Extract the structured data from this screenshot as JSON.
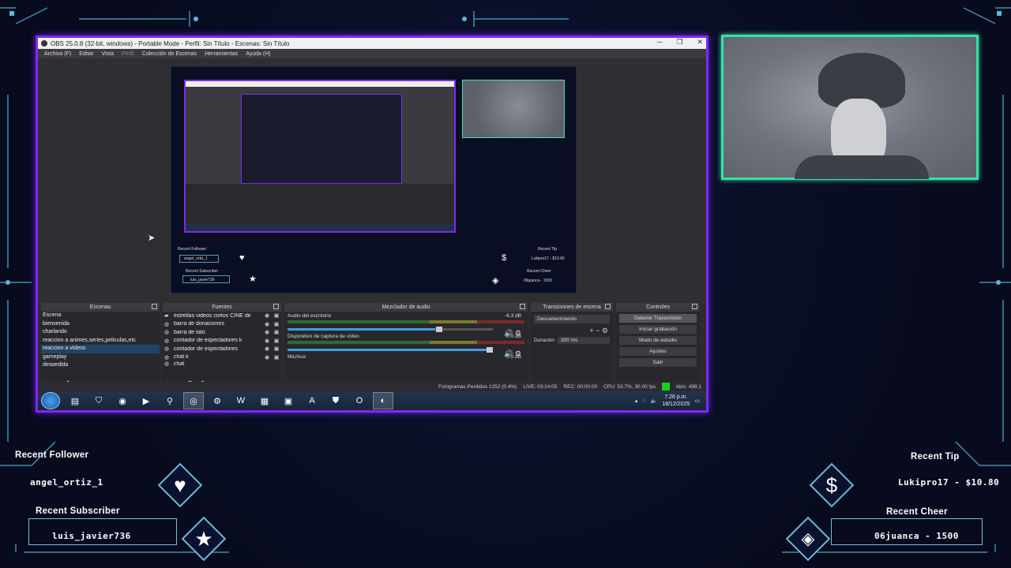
{
  "obs": {
    "title": "OBS 25.0.8 (32-bit, windows) - Portable Mode - Perfil: Sin Título - Escenas: Sin Título",
    "menu": [
      "Archivo (F)",
      "Editar",
      "Vista",
      "Perfil",
      "Colección de Escenas",
      "Herramientas",
      "Ayuda (H)"
    ],
    "docks": {
      "scenes": {
        "header": "Escenas",
        "items": [
          "Escena",
          "bienvenida",
          "charlando",
          "reaccion a animes,series,peliculas,etc",
          "reaccion a videos",
          "gameplay",
          "despedida"
        ],
        "selected_index": 4
      },
      "sources": {
        "header": "Fuentes",
        "items": [
          "estrellas videos cortos CINE de",
          "barra de donaciones",
          "barra de tato",
          "contador de espectadores k",
          "contador de espectadores",
          "chat k",
          "chat"
        ]
      },
      "mixer": {
        "header": "Mezclador de audio",
        "channels": [
          {
            "name": "Audio del escritorio",
            "db": "-6.3 dB",
            "level": 0.72
          },
          {
            "name": "Dispositivo de captura de vídeo",
            "db": "0.0 dB",
            "level": 0.98
          },
          {
            "name": "Mic/Aux",
            "db": "0.0 dB",
            "level": 0.98
          }
        ]
      },
      "transitions": {
        "header": "Transiciones de escena",
        "type": "Desvanecimiento",
        "duration_label": "Duración",
        "duration_value": "300 ms"
      },
      "controls": {
        "header": "Controles",
        "buttons": [
          "Detener Transmisión",
          "Iniciar grabación",
          "Modo de estudio",
          "Ajustes",
          "Salir"
        ]
      }
    },
    "status": {
      "dropped": "Fotogramas Perdidos 1252 (0.4%)",
      "live": "LIVE: 03:14:05",
      "rec": "REC: 00:00:00",
      "cpu": "CPU: 53.7%, 30.00 fps",
      "kbps": "kb/s: 498.1"
    },
    "taskbar": {
      "time": "7:26 p.m.",
      "date": "18/12/2025"
    },
    "preview_mini": {
      "recent_follower": "Recent Follower",
      "follower_name": "angel_ortiz_1",
      "recent_subscriber": "Recent Subscriber",
      "subscriber_name": "luis_javier736",
      "recent_tip": "Recent Tip",
      "tip_value": "Lukipro17 - $10.80",
      "recent_cheer": "Recent Cheer",
      "cheer_value": "06juanca - 1500"
    }
  },
  "widgets": {
    "recent_follower_title": "Recent Follower",
    "recent_follower_value": "angel_ortiz_1",
    "recent_subscriber_title": "Recent Subscriber",
    "recent_subscriber_value": "luis_javier736",
    "recent_tip_title": "Recent Tip",
    "recent_tip_value": "Lukipro17 - $10.80",
    "recent_cheer_title": "Recent Cheer",
    "recent_cheer_value": "06juanca - 1500"
  },
  "icons": {
    "heart": "heart-icon",
    "star": "star-icon",
    "dollar": "dollar-icon",
    "diamond": "diamond-icon"
  },
  "colors": {
    "background": "#070b1d",
    "obs_border": "#7a2bf0",
    "webcam_border": "#38e0a8",
    "frame_lines": "#4fa6c4"
  }
}
